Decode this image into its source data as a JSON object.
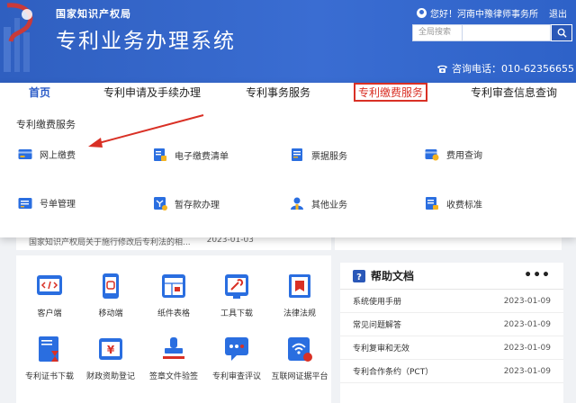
{
  "header": {
    "org_name": "国家知识产权局",
    "system_title": "专利业务办理系统",
    "greeting": "您好！河南中豫律师事务所",
    "logout": "退出",
    "search_scope": "全局搜索",
    "search_placeholder": "",
    "hotline": "咨询电话：010-62356655"
  },
  "nav": {
    "items": [
      {
        "label": "首页"
      },
      {
        "label": "专利申请及手续办理"
      },
      {
        "label": "专利事务服务"
      },
      {
        "label": "专利缴费服务"
      },
      {
        "label": "专利审查信息查询"
      }
    ],
    "active_index": 3
  },
  "dropdown": {
    "title": "专利缴费服务",
    "services": [
      {
        "label": "网上缴费",
        "icon": "credit-card-icon"
      },
      {
        "label": "电子缴费清单",
        "icon": "receipt-list-icon"
      },
      {
        "label": "票据服务",
        "icon": "invoice-icon"
      },
      {
        "label": "费用查询",
        "icon": "fee-query-icon"
      },
      {
        "label": "号单管理",
        "icon": "number-list-icon"
      },
      {
        "label": "暂存款办理",
        "icon": "deposit-icon"
      },
      {
        "label": "其他业务",
        "icon": "user-business-icon"
      },
      {
        "label": "收费标准",
        "icon": "fee-standard-icon"
      }
    ]
  },
  "news_strip": {
    "text": "国家知识产权局关于施行修改后专利法的相...",
    "date": "2023-01-03"
  },
  "tools": [
    {
      "label": "客户端",
      "icon": "code-client-icon"
    },
    {
      "label": "移动端",
      "icon": "mobile-icon"
    },
    {
      "label": "纸件表格",
      "icon": "form-table-icon"
    },
    {
      "label": "工具下载",
      "icon": "tool-download-icon"
    },
    {
      "label": "法律法规",
      "icon": "law-book-icon"
    },
    {
      "label": "专利证书下载",
      "icon": "certificate-icon"
    },
    {
      "label": "财政资助登记",
      "icon": "finance-icon"
    },
    {
      "label": "签章文件验签",
      "icon": "stamp-icon"
    },
    {
      "label": "专利审查评议",
      "icon": "review-chat-icon"
    },
    {
      "label": "互联网证据平台",
      "icon": "wifi-evidence-icon"
    }
  ],
  "help": {
    "title": "帮助文档",
    "more": "•••",
    "items": [
      {
        "title": "系统使用手册",
        "date": "2023-01-09"
      },
      {
        "title": "常见问题解答",
        "date": "2023-01-09"
      },
      {
        "title": "专利复审和无效",
        "date": "2023-01-09"
      },
      {
        "title": "专利合作条约（PCT）",
        "date": "2023-01-09"
      }
    ]
  },
  "colors": {
    "header_blue": "#3a6dd2",
    "active_red": "#d93025",
    "icon_blue": "#2a6ee0",
    "icon_yellow": "#f5b320"
  }
}
